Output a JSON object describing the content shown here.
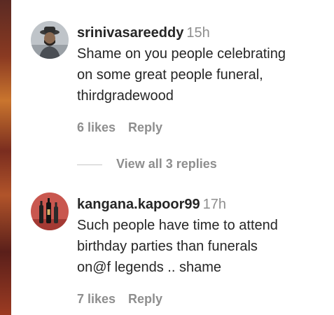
{
  "comments": [
    {
      "username": "srinivasareeddy",
      "time": "15h",
      "text": "Shame on you people celebrating\non some great people funeral,\nthirdgradewood",
      "likes": "6 likes",
      "reply_label": "Reply",
      "avatar": "profile-photo-man-in-hat"
    },
    {
      "username": "kangana.kapoor99",
      "time": "17h",
      "text": "Such people have time to attend\nbirthday parties than funerals\non@f legends .. shame",
      "likes": "7 likes",
      "reply_label": "Reply",
      "avatar": "profile-photo-bottles-red"
    }
  ],
  "view_replies": "View all 3 replies",
  "colors": {
    "primary_text": "#262626",
    "secondary_text": "#8e8e8e",
    "divider": "#c7c7c7"
  }
}
